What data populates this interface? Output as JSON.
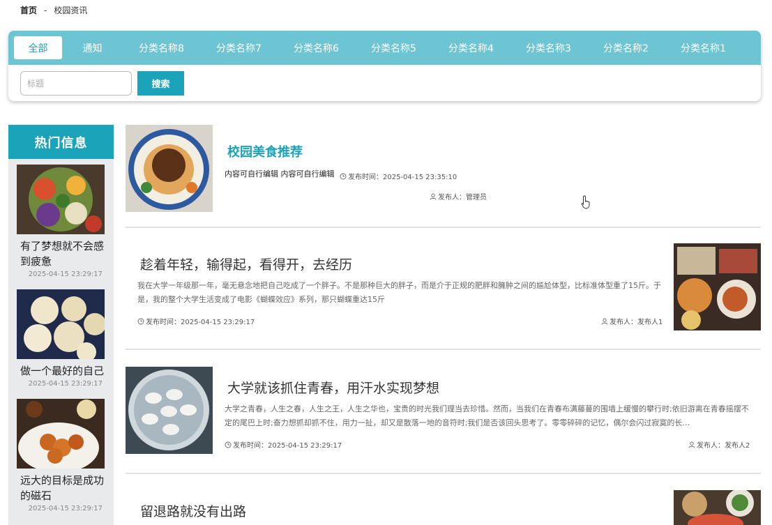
{
  "breadcrumb": {
    "home": "首页",
    "separator": "-",
    "current": "校园资讯"
  },
  "tabs": [
    {
      "label": "全部",
      "active": true
    },
    {
      "label": "通知"
    },
    {
      "label": "分类名称8"
    },
    {
      "label": "分类名称7"
    },
    {
      "label": "分类名称6"
    },
    {
      "label": "分类名称5"
    },
    {
      "label": "分类名称4"
    },
    {
      "label": "分类名称3"
    },
    {
      "label": "分类名称2"
    },
    {
      "label": "分类名称1"
    }
  ],
  "search": {
    "placeholder": "标题",
    "button_label": "搜索"
  },
  "sidebar": {
    "heading": "热门信息",
    "items": [
      {
        "title": "有了梦想就不会感到疲惫",
        "date": "2025-04-15 23:29:17"
      },
      {
        "title": "做一个最好的自己",
        "date": "2025-04-15 23:29:17"
      },
      {
        "title": "远大的目标是成功的磁石",
        "date": "2025-04-15 23:29:17"
      }
    ]
  },
  "news": [
    {
      "title": "校园美食推荐",
      "summary": "内容可自行编辑 内容可自行编辑",
      "time_label": "发布时间：2025-04-15 23:35:10",
      "author_label": "发布人：管理员"
    },
    {
      "title": "趁着年轻，输得起，看得开，去经历",
      "summary": "我在大学一年级那一年，毫无悬念地把自己吃成了一个胖子。不是那种巨大的胖子，而是介于正规的肥胖和臃肿之间的尴尬体型，比标准体型重了15斤。于是，我的整个大学生活变成了电影《蝴蝶效应》系列，那只蝴蝶重达15斤",
      "time_label": "发布时间：2025-04-15 23:29:17",
      "author_label": "发布人：发布人1"
    },
    {
      "title": "大学就该抓住青春，用汗水实现梦想",
      "summary": "大学之青春，人生之春，人生之王，人生之华也，宝贵的时光我们理当去珍惜。然而，当我们在青春布满藤蔓的围墙上缓慢的攀行时;依旧游离在青春摇摆不定的尾巴上时;奋力想抓却抓不住，用力一扯，却又是散落一地的音符时;我们是否该回头思考了。零零碎碎的记忆，偶尔会闪过寂寞的长…",
      "time_label": "发布时间：2025-04-15 23:29:17",
      "author_label": "发布人：发布人2"
    },
    {
      "title": "留退路就没有出路"
    }
  ],
  "colors": {
    "accent": "#1aa3b9",
    "tabbar": "#6dc4d2",
    "sidebar_bg": "#e9eaec"
  },
  "icons": {
    "time": "clock-icon",
    "author": "user-icon"
  }
}
